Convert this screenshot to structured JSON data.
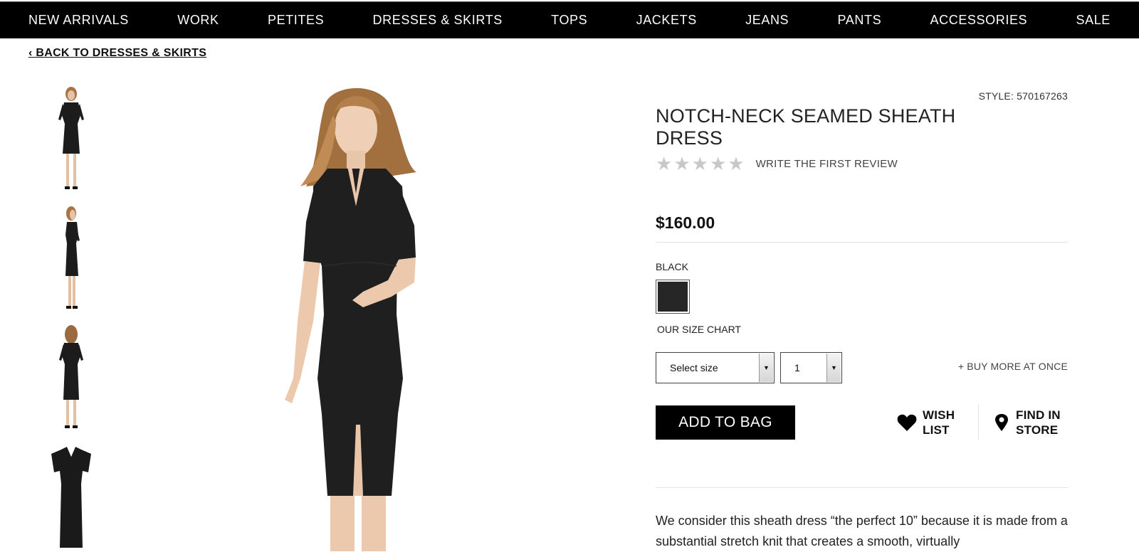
{
  "nav": {
    "items": [
      "NEW ARRIVALS",
      "WORK",
      "PETITES",
      "DRESSES & SKIRTS",
      "TOPS",
      "JACKETS",
      "JEANS",
      "PANTS",
      "ACCESSORIES",
      "SALE"
    ]
  },
  "back_link": "‹ BACK TO DRESSES & SKIRTS",
  "thumbnails": [
    "front view",
    "side view",
    "back view",
    "flat lay"
  ],
  "product": {
    "style": "STYLE: 570167263",
    "title": "NOTCH-NECK SEAMED SHEATH DRESS",
    "rating": {
      "stars_filled": 0,
      "stars_total": 5,
      "review_link": "WRITE THE FIRST REVIEW"
    },
    "price": "$160.00",
    "color_name": "BLACK",
    "swatch_color": "#262626",
    "size_chart": "OUR SIZE CHART",
    "size_select": "Select size",
    "qty_select": "1",
    "buy_more": "+ BUY MORE AT ONCE",
    "add_to_bag": "ADD TO BAG",
    "wish_list": {
      "line1": "WISH",
      "line2": "LIST"
    },
    "find_in_store": {
      "line1": "FIND IN",
      "line2": "STORE"
    },
    "description": "We consider this sheath dress “the perfect 10” because it is made from a substantial stretch knit that creates a smooth, virtually"
  },
  "colors": {
    "nav_bg": "#000000",
    "nav_text": "#ffffff",
    "button_bg": "#000000",
    "star_empty": "#c8c8c8"
  }
}
